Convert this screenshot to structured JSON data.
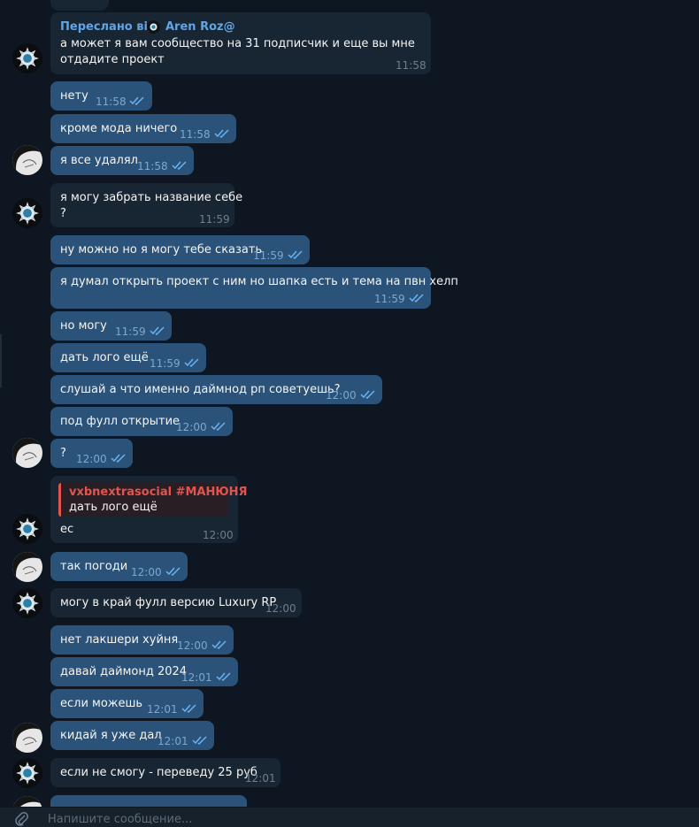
{
  "app": {
    "accent": "#5ea6e8",
    "background": "#0e1621",
    "bubble_in": "#182533",
    "bubble_out": "#2b5278"
  },
  "forward": {
    "label": "Переслано від",
    "name": "Aren Roz@"
  },
  "reply": {
    "name": "vxbnextrasocial #МАНЮНЯ",
    "text": "дать лого ещё"
  },
  "messages": [
    {
      "text": "а может я вам сообщество на 31 подписчик и еще вы мне",
      "text2": "отдадите проект",
      "time": "11:58",
      "dir": "in"
    },
    {
      "text": "нету",
      "time": "11:58",
      "dir": "out"
    },
    {
      "text": "кроме мода ничего",
      "time": "11:58",
      "dir": "out"
    },
    {
      "text": "я все удалял",
      "time": "11:58",
      "dir": "out"
    },
    {
      "text": "я могу забрать название себе",
      "text2": "?",
      "time": "11:59",
      "dir": "in"
    },
    {
      "text": "ну можно но я могу тебе сказать",
      "time": "11:59",
      "dir": "out"
    },
    {
      "text": "я думал открыть проект с ним но шапка есть и тема на пвн хелп",
      "time": "11:59",
      "dir": "out"
    },
    {
      "text": "но могу",
      "time": "11:59",
      "dir": "out"
    },
    {
      "text": "дать лого ещё",
      "time": "11:59",
      "dir": "out"
    },
    {
      "text": "слушай а что именно даймнод рп советуешь?",
      "time": "12:00",
      "dir": "out"
    },
    {
      "text": "под фулл открытие",
      "time": "12:00",
      "dir": "out"
    },
    {
      "text": "?",
      "time": "12:00",
      "dir": "out"
    },
    {
      "text": "ес",
      "time": "12:00",
      "dir": "in"
    },
    {
      "text": "так погоди",
      "time": "12:00",
      "dir": "out"
    },
    {
      "text": "могу в край фулл версию Luxury RP",
      "time": "12:00",
      "dir": "in"
    },
    {
      "text": "нет лакшери хуйня",
      "time": "12:00",
      "dir": "out"
    },
    {
      "text": "давай даймонд 2024",
      "time": "12:01",
      "dir": "out"
    },
    {
      "text": "если можешь",
      "time": "12:01",
      "dir": "out"
    },
    {
      "text": "кидай я уже дал",
      "time": "12:01",
      "dir": "out"
    },
    {
      "text": "если не смогу - переведу 25 руб",
      "time": "12:01",
      "dir": "in"
    }
  ],
  "input": {
    "placeholder": "Напишите сообщение..."
  },
  "icons": {
    "read": "double-check-icon",
    "attach": "paperclip-icon"
  }
}
